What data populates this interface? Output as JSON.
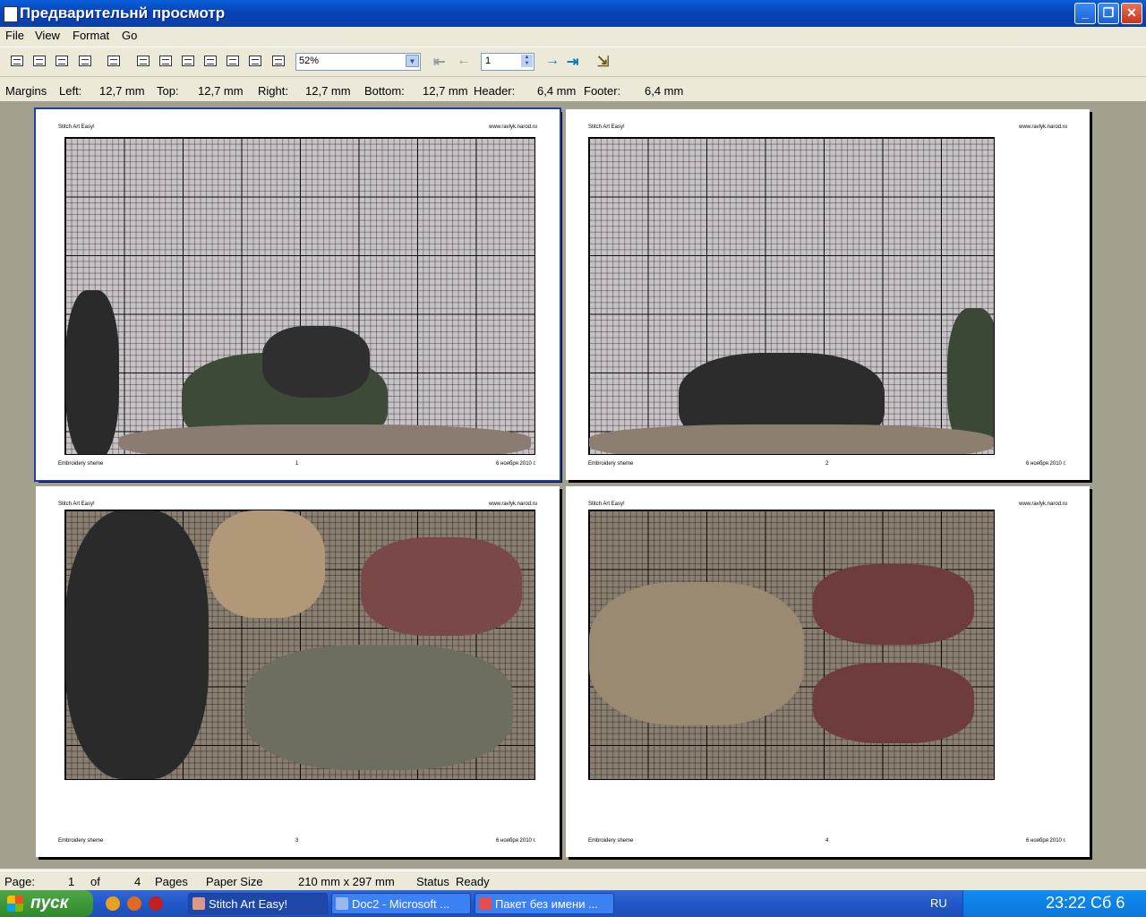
{
  "window": {
    "title": "Предварительнй просмотр"
  },
  "menu": {
    "file": "File",
    "view": "View",
    "format": "Format",
    "go": "Go"
  },
  "toolbar": {
    "zoom": "52%",
    "page_number": "1"
  },
  "margins": {
    "label": "Margins",
    "left_label": "Left:",
    "left_value": "12,7 mm",
    "top_label": "Top:",
    "top_value": "12,7 mm",
    "right_label": "Right:",
    "right_value": "12,7 mm",
    "bottom_label": "Bottom:",
    "bottom_value": "12,7 mm",
    "header_label": "Header:",
    "header_value": "6,4 mm",
    "footer_label": "Footer:",
    "footer_value": "6,4 mm"
  },
  "pages": [
    {
      "header_left": "Stitch Art Easy!",
      "header_right": "www.ravlyk.narod.ru",
      "footer_left": "Embroidery sheme",
      "footer_num": "1",
      "footer_right": "6 ноября 2010 г."
    },
    {
      "header_left": "Stitch Art Easy!",
      "header_right": "www.ravlyk.narod.ru",
      "footer_left": "Embroidery sheme",
      "footer_num": "2",
      "footer_right": "6 ноября 2010 г."
    },
    {
      "header_left": "Stitch Art Easy!",
      "header_right": "www.ravlyk.narod.ru",
      "footer_left": "Embroidery sheme",
      "footer_num": "3",
      "footer_right": "6 ноября 2010 г."
    },
    {
      "header_left": "Stitch Art Easy!",
      "header_right": "www.ravlyk.narod.ru",
      "footer_left": "Embroidery sheme",
      "footer_num": "4",
      "footer_right": "6 ноября 2010 г."
    }
  ],
  "status": {
    "page_label": "Page:",
    "page_value": "1",
    "of_label": "of",
    "total_pages": "4",
    "pages_label": "Pages",
    "paper_label": "Paper Size",
    "paper_value": "210 mm x 297 mm",
    "status_label": "Status",
    "status_value": "Ready"
  },
  "taskbar": {
    "start": "пуск",
    "tasks": [
      "Stitch Art Easy!",
      "Doc2 - Microsoft ...",
      "Пакет без имени ..."
    ],
    "lang": "RU",
    "clock": "23:22 Сб 6"
  },
  "colors": {
    "titlebar": "#0a5fd9",
    "workspace": "#a3a08f",
    "taskbar": "#2157c8",
    "start": "#3a9a36"
  }
}
